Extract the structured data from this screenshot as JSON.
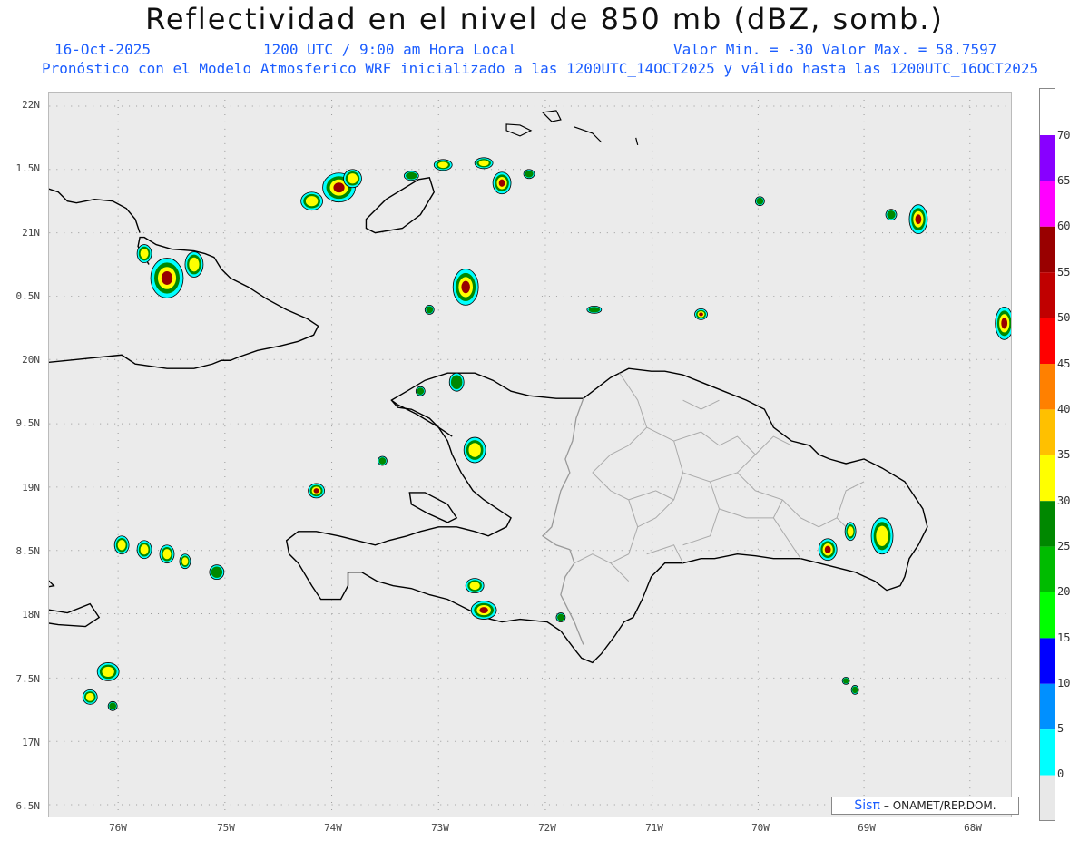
{
  "header": {
    "title": "Reflectividad en el nivel de 850 mb (dBZ, somb.)",
    "date": "16-Oct-2025",
    "time": "1200 UTC / 9:00 am Hora Local",
    "minmax": "Valor Min. = -30  Valor Max. = 58.7597",
    "forecast": "Pronóstico con el Modelo Atmosferico WRF inicializado a las 1200UTC_14OCT2025 y válido hasta las  1200UTC_16OCT2025"
  },
  "axes": {
    "lat_labels": [
      "22N",
      "1.5N",
      "21N",
      "0.5N",
      "20N",
      "9.5N",
      "19N",
      "8.5N",
      "18N",
      "7.5N",
      "17N",
      "6.5N"
    ],
    "lon_labels": [
      "76W",
      "75W",
      "74W",
      "73W",
      "72W",
      "71W",
      "70W",
      "69W",
      "68W"
    ]
  },
  "colorbar": {
    "labels": [
      "70",
      "65",
      "60",
      "55",
      "50",
      "45",
      "40",
      "35",
      "30",
      "25",
      "20",
      "15",
      "10",
      "5",
      "0"
    ],
    "colors": [
      "#8800ff",
      "#ff00ff",
      "#990000",
      "#c00000",
      "#ff0000",
      "#ff8000",
      "#ffc000",
      "#ffff00",
      "#008800",
      "#00bb00",
      "#00ff00",
      "#0000ff",
      "#0090ff",
      "#00ffff",
      "#e8e8e8"
    ]
  },
  "credit": {
    "logo": "Sisπ",
    "text": "– ONAMET/REP.DOM."
  }
}
